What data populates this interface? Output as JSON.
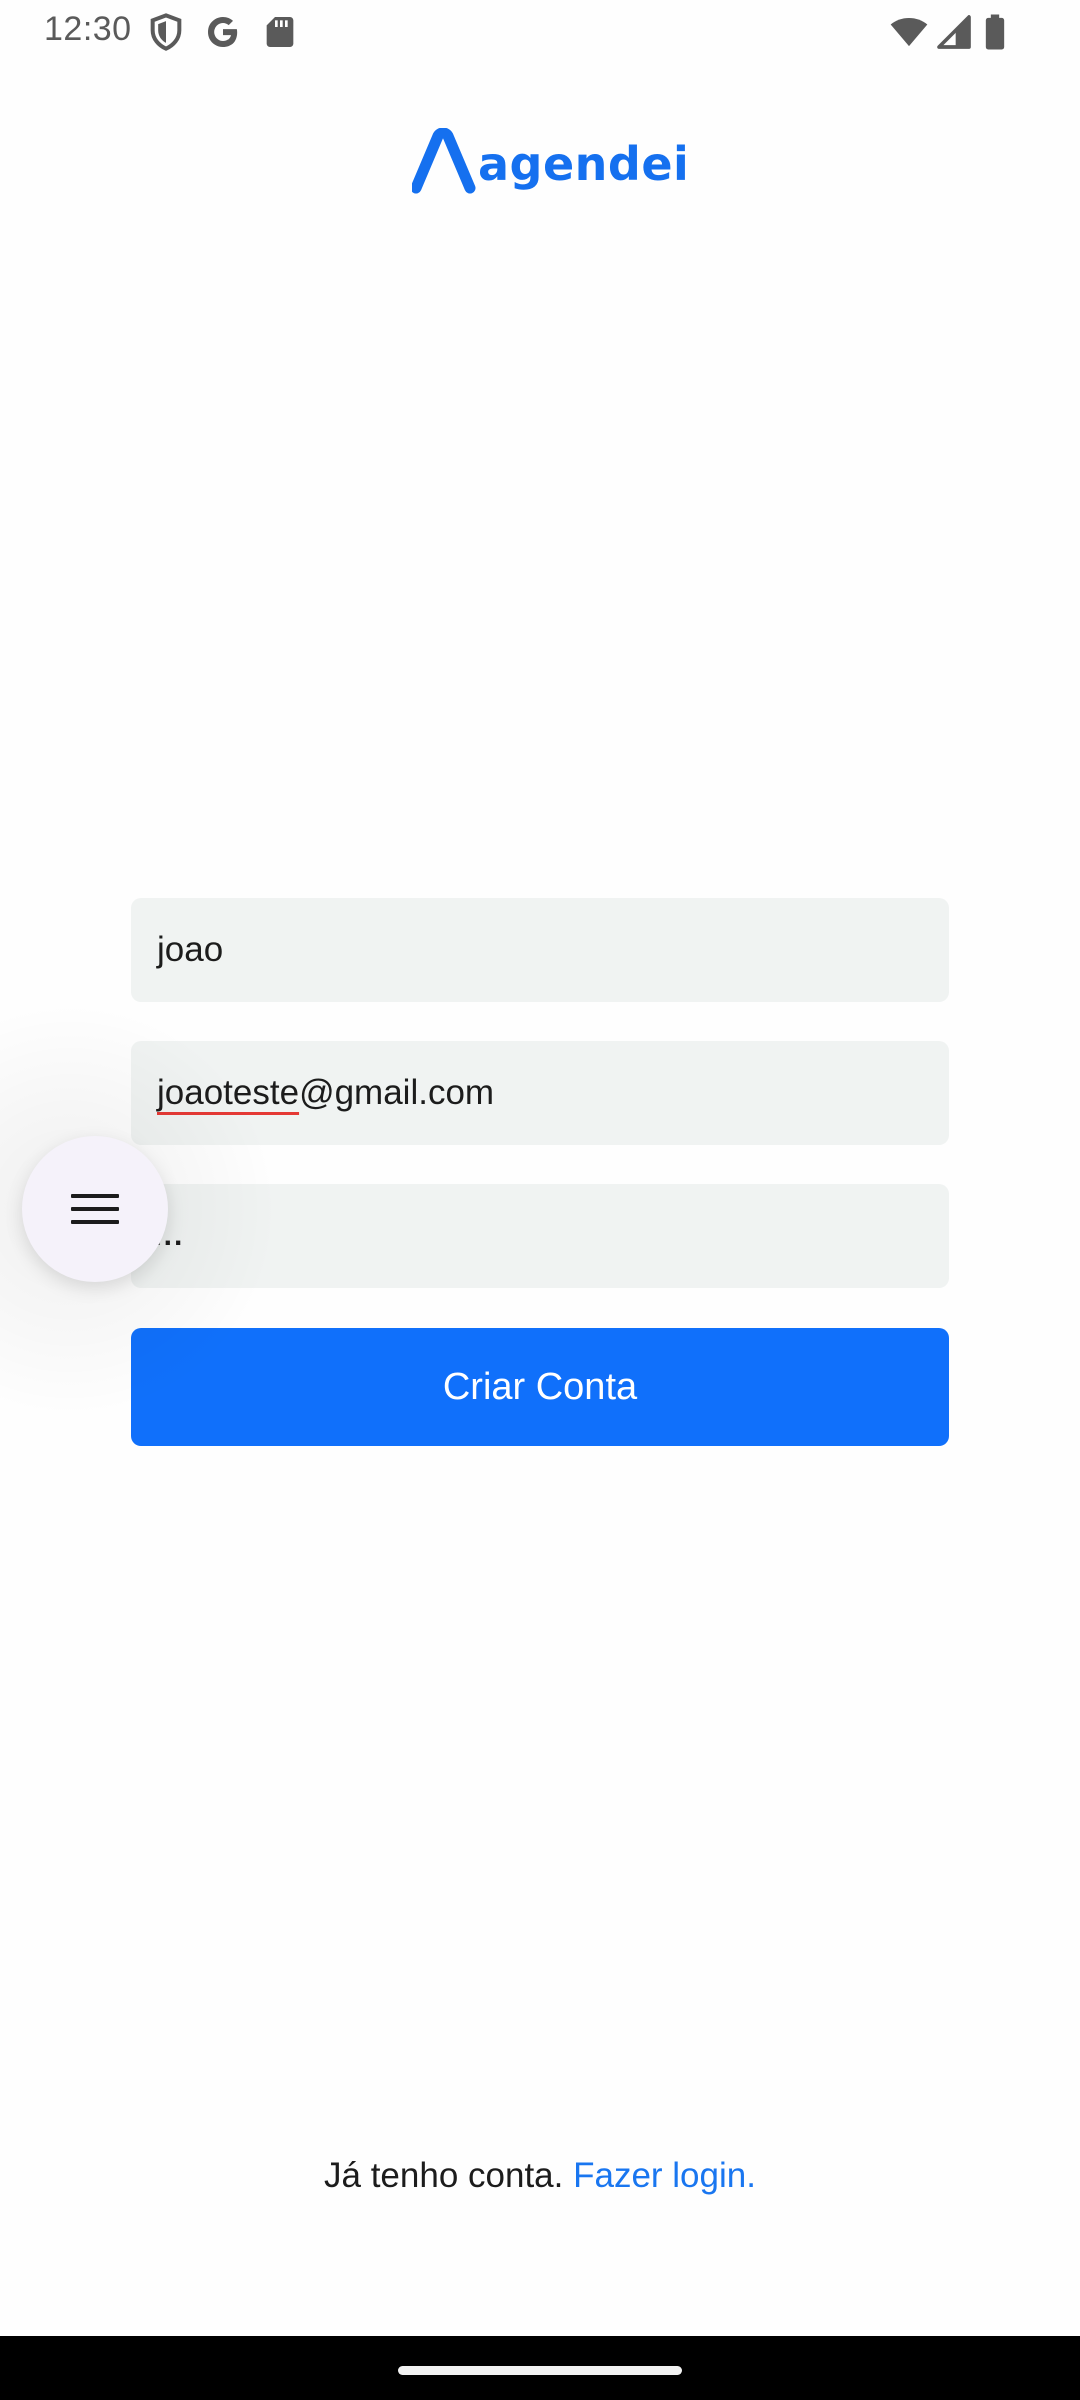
{
  "status_bar": {
    "time": "12:30",
    "left_icons": [
      "shield-icon",
      "google-icon",
      "sd-card-icon"
    ],
    "right_icons": [
      "wifi-icon",
      "cell-signal-icon",
      "battery-icon"
    ]
  },
  "app": {
    "logo_text": "agendei",
    "brand_color": "#1570ef"
  },
  "form": {
    "name_value": "joao",
    "email_misspelled": "joaoteste",
    "email_rest": "@gmail.com",
    "password_masked": "....",
    "submit_label": "Criar Conta",
    "button_color": "#1070fb"
  },
  "fab": {
    "icon": "menu-icon"
  },
  "footer": {
    "prompt_text": "Já tenho conta.",
    "link_text": "Fazer login."
  }
}
